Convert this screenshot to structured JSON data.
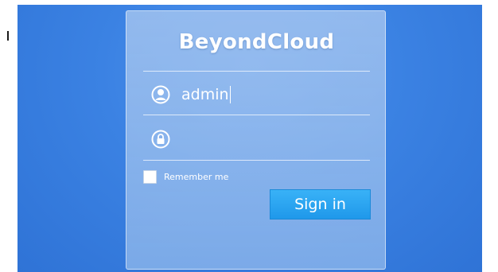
{
  "login": {
    "brand": "BeyondCloud",
    "username_value": "admin",
    "password_value": "",
    "remember_label": "Remember me",
    "remember_checked": false,
    "signin_label": "Sign in"
  },
  "icons": {
    "username": "user-icon",
    "password": "lock-icon"
  },
  "colors": {
    "background": "#3b82e3",
    "button": "#2aa5f2",
    "text": "#ffffff"
  }
}
